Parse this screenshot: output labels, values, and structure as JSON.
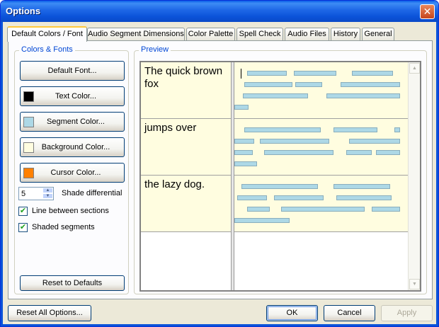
{
  "window": {
    "title": "Options",
    "close_glyph": "✕"
  },
  "tabs": [
    {
      "label": "Default Colors / Font",
      "active": true
    },
    {
      "label": "Audio Segment Dimensions"
    },
    {
      "label": "Color Palette"
    },
    {
      "label": "Spell Check"
    },
    {
      "label": "Audio Files"
    },
    {
      "label": "History"
    },
    {
      "label": "General"
    }
  ],
  "colors_fonts": {
    "legend": "Colors & Fonts",
    "default_font_label": "Default Font...",
    "text_color_label": "Text Color...",
    "segment_color_label": "Segment Color...",
    "background_color_label": "Background Color...",
    "cursor_color_label": "Cursor Color...",
    "text_color": "#000000",
    "segment_color": "#add8e6",
    "background_color": "#fffde0",
    "cursor_color": "#ff8000",
    "shade_differential_value": "5",
    "shade_differential_label": "Shade differential",
    "line_between_sections_label": "Line between sections",
    "line_between_sections_checked": true,
    "shaded_segments_label": "Shaded segments",
    "shaded_segments_checked": true,
    "reset_defaults_label": "Reset to Defaults"
  },
  "preview": {
    "legend": "Preview",
    "segments": [
      {
        "text": "The quick brown fox"
      },
      {
        "text": "jumps over"
      },
      {
        "text": "the lazy dog."
      }
    ]
  },
  "footer": {
    "reset_all_label": "Reset All Options...",
    "ok_label": "OK",
    "cancel_label": "Cancel",
    "apply_label": "Apply"
  },
  "check_glyph": "✔",
  "spin_up_glyph": "▲",
  "spin_down_glyph": "▼"
}
